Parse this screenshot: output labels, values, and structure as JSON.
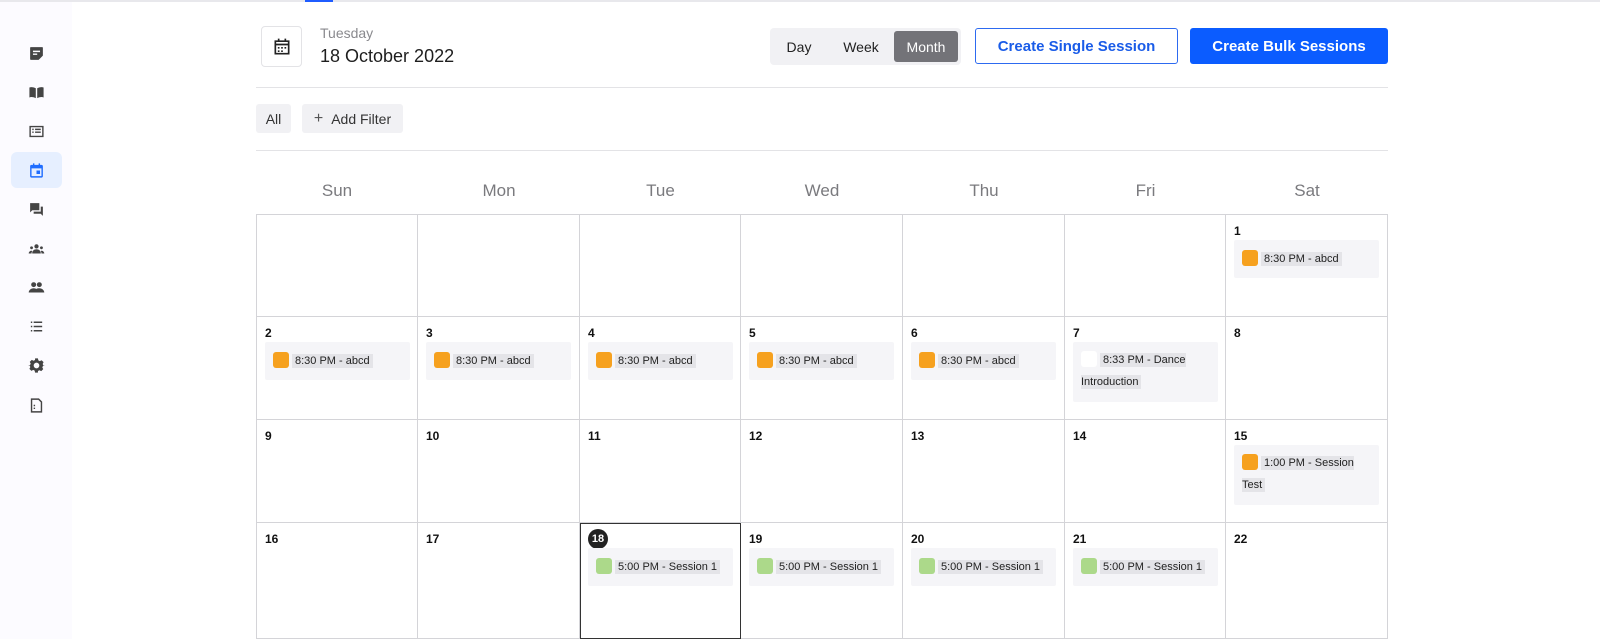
{
  "header": {
    "weekday": "Tuesday",
    "date": "18 October 2022"
  },
  "view_toggle": {
    "options": [
      "Day",
      "Week",
      "Month"
    ],
    "selected": "Month"
  },
  "actions": {
    "create_single": "Create Single Session",
    "create_bulk": "Create Bulk Sessions"
  },
  "filters": {
    "all": "All",
    "add_filter": "Add Filter"
  },
  "sidebar": {
    "items": [
      {
        "icon": "notes-icon"
      },
      {
        "icon": "book-icon"
      },
      {
        "icon": "list-box-icon"
      },
      {
        "icon": "calendar-icon",
        "active": true
      },
      {
        "icon": "chat-icon"
      },
      {
        "icon": "groups-icon"
      },
      {
        "icon": "people-icon"
      },
      {
        "icon": "bullet-list-icon"
      },
      {
        "icon": "gear-icon"
      },
      {
        "icon": "document-icon"
      }
    ]
  },
  "calendar": {
    "weekdays": [
      "Sun",
      "Mon",
      "Tue",
      "Wed",
      "Thu",
      "Fri",
      "Sat"
    ],
    "today": "18",
    "colors": {
      "orange": "#f6a11f",
      "green": "#acd98a",
      "white": "#ffffff",
      "accent": "#0b5cff"
    },
    "weeks": [
      [
        {
          "day": "",
          "events": []
        },
        {
          "day": "",
          "events": []
        },
        {
          "day": "",
          "events": []
        },
        {
          "day": "",
          "events": []
        },
        {
          "day": "",
          "events": []
        },
        {
          "day": "",
          "events": []
        },
        {
          "day": "1",
          "events": [
            {
              "label": "8:30 PM - abcd",
              "color": "#f6a11f"
            }
          ]
        }
      ],
      [
        {
          "day": "2",
          "events": [
            {
              "label": "8:30 PM - abcd",
              "color": "#f6a11f"
            }
          ]
        },
        {
          "day": "3",
          "events": [
            {
              "label": "8:30 PM - abcd",
              "color": "#f6a11f"
            }
          ]
        },
        {
          "day": "4",
          "events": [
            {
              "label": "8:30 PM - abcd",
              "color": "#f6a11f"
            }
          ]
        },
        {
          "day": "5",
          "events": [
            {
              "label": "8:30 PM - abcd",
              "color": "#f6a11f"
            }
          ]
        },
        {
          "day": "6",
          "events": [
            {
              "label": "8:30 PM - abcd",
              "color": "#f6a11f"
            }
          ]
        },
        {
          "day": "7",
          "events": [
            {
              "label": "8:33 PM - Dance Introduction",
              "color": "#ffffff"
            }
          ]
        },
        {
          "day": "8",
          "events": []
        }
      ],
      [
        {
          "day": "9",
          "events": []
        },
        {
          "day": "10",
          "events": []
        },
        {
          "day": "11",
          "events": []
        },
        {
          "day": "12",
          "events": []
        },
        {
          "day": "13",
          "events": []
        },
        {
          "day": "14",
          "events": []
        },
        {
          "day": "15",
          "events": [
            {
              "label": "1:00 PM - Session Test",
              "color": "#f6a11f"
            }
          ]
        }
      ],
      [
        {
          "day": "16",
          "events": []
        },
        {
          "day": "17",
          "events": []
        },
        {
          "day": "18",
          "events": [
            {
              "label": "5:00 PM - Session 1",
              "color": "#acd98a"
            }
          ]
        },
        {
          "day": "19",
          "events": [
            {
              "label": "5:00 PM - Session 1",
              "color": "#acd98a"
            }
          ]
        },
        {
          "day": "20",
          "events": [
            {
              "label": "5:00 PM - Session 1",
              "color": "#acd98a"
            }
          ]
        },
        {
          "day": "21",
          "events": [
            {
              "label": "5:00 PM - Session 1",
              "color": "#acd98a"
            }
          ]
        },
        {
          "day": "22",
          "events": []
        }
      ]
    ]
  }
}
